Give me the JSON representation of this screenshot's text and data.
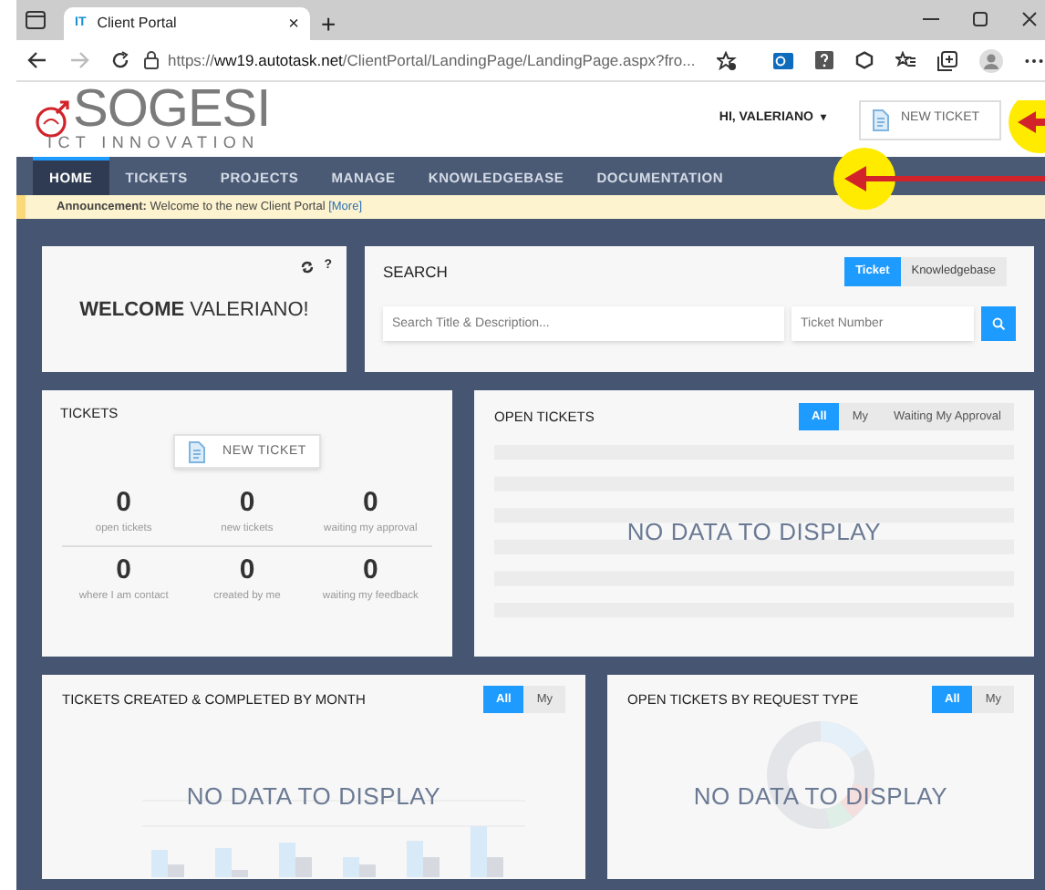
{
  "browser": {
    "tab": {
      "favicon": "IT",
      "title": "Client Portal",
      "close": "×"
    },
    "new_tab": "+",
    "url": {
      "scheme": "https://",
      "host": "ww19.autotask.net",
      "path": "/ClientPortal/LandingPage/LandingPage.aspx?fro..."
    }
  },
  "header": {
    "logo": "SOGESI",
    "logo_subtitle": "ICT INNOVATION",
    "user": "HI, VALERIANO",
    "user_caret": "▾",
    "new_ticket": "NEW TICKET"
  },
  "nav": [
    {
      "label": "HOME",
      "selected": true
    },
    {
      "label": "TICKETS",
      "selected": false
    },
    {
      "label": "PROJECTS",
      "selected": false
    },
    {
      "label": "MANAGE",
      "selected": false
    },
    {
      "label": "KNOWLEDGEBASE",
      "selected": false
    },
    {
      "label": "DOCUMENTATION",
      "selected": false
    }
  ],
  "announcement": {
    "label": "Announcement:",
    "text": "Welcome to the new Client Portal",
    "link": "[More]"
  },
  "welcome": {
    "text": "**WELCOME** VALERIANO!",
    "help": "?"
  },
  "search": {
    "title": "SEARCH",
    "modes": [
      {
        "label": "Ticket",
        "selected": true
      },
      {
        "label": "Knowledgebase",
        "selected": false
      }
    ],
    "text_placeholder": "Search Title & Description...",
    "number_placeholder": "Ticket Number"
  },
  "tickets": {
    "title": "TICKETS",
    "button": "NEW TICKET",
    "stats": [
      {
        "value": "0",
        "label": "open tickets"
      },
      {
        "value": "0",
        "label": "new tickets"
      },
      {
        "value": "0",
        "label": "waiting my approval"
      },
      {
        "value": "0",
        "label": "where I am contact"
      },
      {
        "value": "0",
        "label": "created by me"
      },
      {
        "value": "0",
        "label": "waiting my feedback"
      }
    ]
  },
  "open_tickets": {
    "title": "OPEN TICKETS",
    "filters": [
      {
        "label": "All",
        "selected": true
      },
      {
        "label": "My",
        "selected": false
      },
      {
        "label": "Waiting My Approval",
        "selected": false
      }
    ],
    "empty": "NO DATA TO DISPLAY"
  },
  "by_month": {
    "title": "TICKETS CREATED & COMPLETED BY MONTH",
    "filters": [
      {
        "label": "All",
        "selected": true
      },
      {
        "label": "My",
        "selected": false
      }
    ],
    "empty": "NO DATA TO DISPLAY"
  },
  "by_type": {
    "title": "OPEN TICKETS BY REQUEST TYPE",
    "filters": [
      {
        "label": "All",
        "selected": true
      },
      {
        "label": "My",
        "selected": false
      }
    ],
    "empty": "NO DATA TO DISPLAY"
  }
}
